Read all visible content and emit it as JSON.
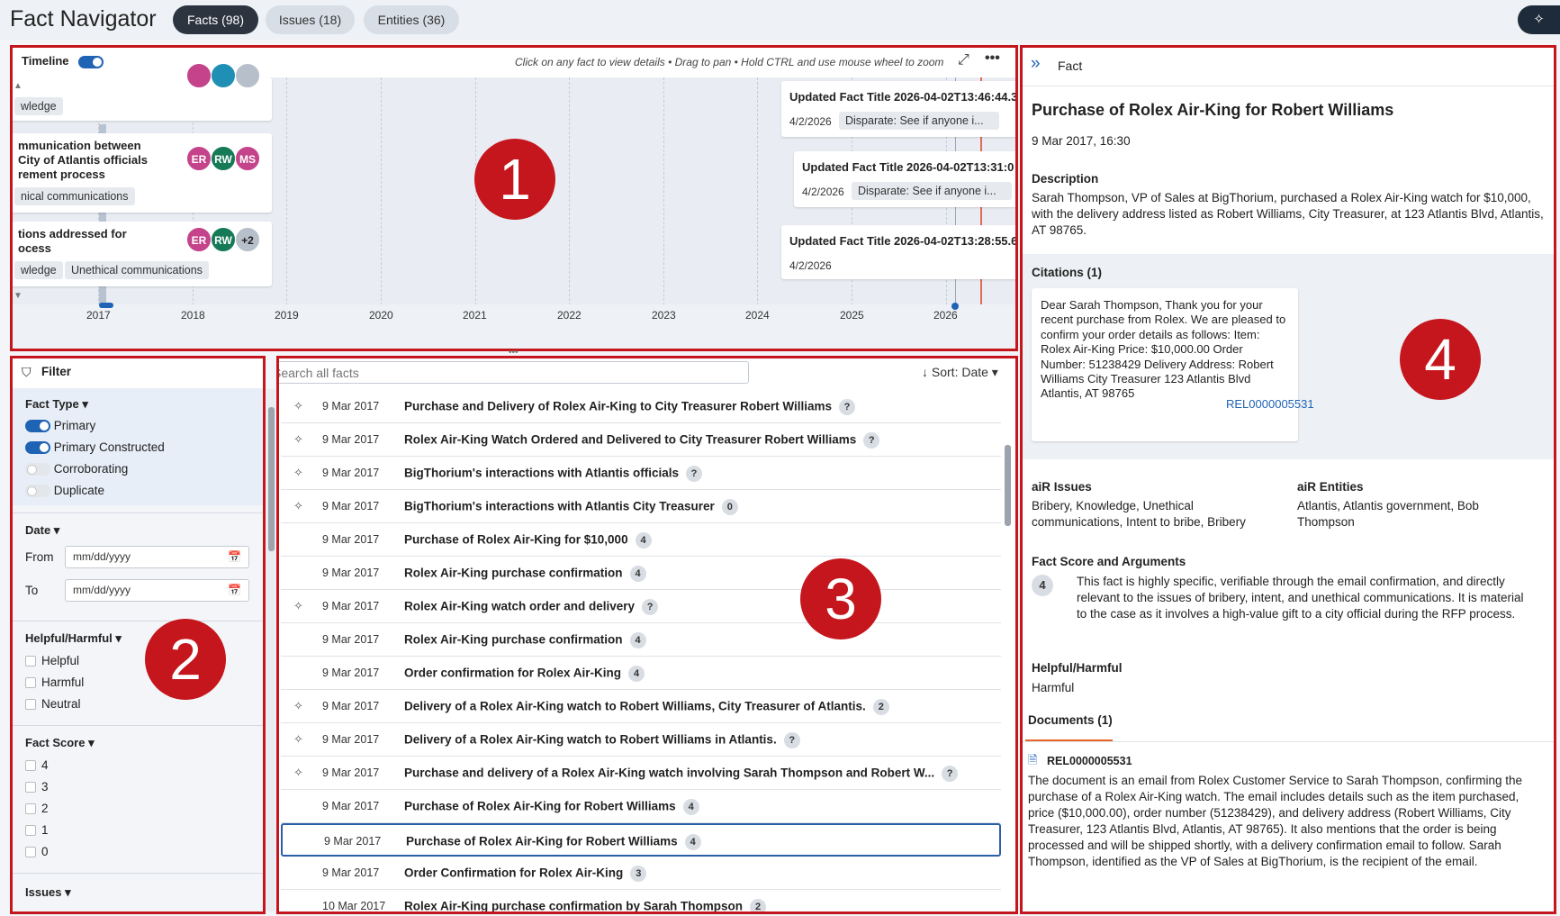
{
  "app": {
    "title": "Fact Navigator"
  },
  "tabs": [
    {
      "label": "Facts (98)"
    },
    {
      "label": "Issues (18)"
    },
    {
      "label": "Entities (36)"
    }
  ],
  "callouts": [
    "1",
    "2",
    "3",
    "4"
  ],
  "timeline": {
    "title": "Timeline",
    "hint": "Click on any fact to view details • Drag to pan • Hold CTRL and use mouse wheel to zoom",
    "years": [
      "2017",
      "2018",
      "2019",
      "2020",
      "2021",
      "2022",
      "2023",
      "2024",
      "2025",
      "2026"
    ],
    "left_cards": [
      {
        "lines": [],
        "chips": [
          "wledge"
        ]
      },
      {
        "lines": [
          "mmunication between",
          "City of Atlantis officials",
          "rement process"
        ],
        "chips": [
          "nical communications"
        ],
        "avatars": [
          "ER",
          "RW",
          "MS"
        ]
      },
      {
        "lines": [
          "tions addressed for",
          "ocess"
        ],
        "chips": [
          "wledge",
          "Unethical communications"
        ],
        "avatars": [
          "ER",
          "RW",
          "+2"
        ]
      }
    ],
    "right_cards": [
      {
        "title": "Updated Fact Title 2026-04-02T13:46:44.3",
        "date": "4/2/2026",
        "chip": "Disparate: See if anyone i..."
      },
      {
        "title": "Updated Fact Title 2026-04-02T13:31:0",
        "date": "4/2/2026",
        "chip": "Disparate: See if anyone i..."
      },
      {
        "title": "Updated Fact Title 2026-04-02T13:28:55.6",
        "date": "4/2/2026"
      }
    ]
  },
  "filter": {
    "title": "Filter",
    "fact_type": {
      "label": "Fact Type",
      "options": [
        {
          "label": "Primary",
          "on": true
        },
        {
          "label": "Primary Constructed",
          "on": true
        },
        {
          "label": "Corroborating",
          "on": false
        },
        {
          "label": "Duplicate",
          "on": false
        }
      ]
    },
    "date": {
      "label": "Date",
      "from_label": "From",
      "to_label": "To",
      "placeholder": "mm/dd/yyyy"
    },
    "helpful": {
      "label": "Helpful/Harmful",
      "options": [
        "Helpful",
        "Harmful",
        "Neutral"
      ]
    },
    "score": {
      "label": "Fact Score",
      "options": [
        "4",
        "3",
        "2",
        "1",
        "0"
      ]
    },
    "issues": {
      "label": "Issues"
    }
  },
  "list": {
    "search_placeholder": "Search all facts",
    "sort_label": "Sort: Date",
    "rows": [
      {
        "ai": true,
        "date": "9 Mar 2017",
        "title": "Purchase and Delivery of Rolex Air-King to City Treasurer Robert Williams",
        "count": "?"
      },
      {
        "ai": true,
        "date": "9 Mar 2017",
        "title": "Rolex Air-King Watch Ordered and Delivered to City Treasurer Robert Williams",
        "count": "?"
      },
      {
        "ai": true,
        "date": "9 Mar 2017",
        "title": "BigThorium's interactions with Atlantis officials",
        "count": "?"
      },
      {
        "ai": true,
        "date": "9 Mar 2017",
        "title": "BigThorium's interactions with Atlantis City Treasurer",
        "count": "0"
      },
      {
        "ai": false,
        "date": "9 Mar 2017",
        "title": "Purchase of Rolex Air-King for $10,000",
        "count": "4"
      },
      {
        "ai": false,
        "date": "9 Mar 2017",
        "title": "Rolex Air-King purchase confirmation",
        "count": "4"
      },
      {
        "ai": true,
        "date": "9 Mar 2017",
        "title": "Rolex Air-King watch order and delivery",
        "count": "?"
      },
      {
        "ai": false,
        "date": "9 Mar 2017",
        "title": "Rolex Air-King purchase confirmation",
        "count": "4"
      },
      {
        "ai": false,
        "date": "9 Mar 2017",
        "title": "Order confirmation for Rolex Air-King",
        "count": "4"
      },
      {
        "ai": true,
        "date": "9 Mar 2017",
        "title": "Delivery of a Rolex Air-King watch to Robert Williams, City Treasurer of Atlantis.",
        "count": "2"
      },
      {
        "ai": true,
        "date": "9 Mar 2017",
        "title": "Delivery of a Rolex Air-King watch to Robert Williams in Atlantis.",
        "count": "?"
      },
      {
        "ai": true,
        "date": "9 Mar 2017",
        "title": "Purchase and delivery of a Rolex Air-King watch involving Sarah Thompson and Robert W...",
        "count": "?"
      },
      {
        "ai": false,
        "date": "9 Mar 2017",
        "title": "Purchase of Rolex Air-King for Robert Williams",
        "count": "4"
      },
      {
        "ai": false,
        "date": "9 Mar 2017",
        "title": "Purchase of Rolex Air-King for Robert Williams",
        "count": "4",
        "selected": true
      },
      {
        "ai": false,
        "date": "9 Mar 2017",
        "title": "Order Confirmation for Rolex Air-King",
        "count": "3"
      },
      {
        "ai": false,
        "date": "10 Mar 2017",
        "title": "Rolex Air-King purchase confirmation by Sarah Thompson",
        "count": "2"
      }
    ]
  },
  "detail": {
    "header": "Fact",
    "title": "Purchase of Rolex Air-King for Robert Williams",
    "datetime": "9 Mar 2017, 16:30",
    "desc_label": "Description",
    "desc": "Sarah Thompson, VP of Sales at BigThorium, purchased a Rolex Air-King watch for $10,000, with the delivery address listed as Robert Williams, City Treasurer, at 123 Atlantis Blvd, Atlantis, AT 98765.",
    "citations_label": "Citations (1)",
    "citation_text": "Dear Sarah Thompson, Thank you for your recent purchase from Rolex. We are pleased to confirm your order details as follows: Item: Rolex Air-King Price: $10,000.00 Order Number: 51238429 Delivery Address: Robert Williams City Treasurer 123 Atlantis Blvd Atlantis, AT 98765",
    "citation_ref": "REL0000005531",
    "issues_label": "aiR Issues",
    "issues": "Bribery, Knowledge, Unethical communications, Intent to bribe, Bribery",
    "entities_label": "aiR Entities",
    "entities": "Atlantis, Atlantis government, Bob Thompson",
    "score_label": "Fact Score and Arguments",
    "score": "4",
    "score_text": "This fact is highly specific, verifiable through the email confirmation, and directly relevant to the issues of bribery, intent, and unethical communications. It is material to the case as it involves a high-value gift to a city official during the RFP process.",
    "hh_label": "Helpful/Harmful",
    "hh_value": "Harmful",
    "documents_label": "Documents (1)",
    "doc_ref": "REL0000005531",
    "doc_text": "The document is an email from Rolex Customer Service to Sarah Thompson, confirming the purchase of a Rolex Air-King watch. The email includes details such as the item purchased, price ($10,000.00), order number (51238429), and delivery address (Robert Williams, City Treasurer, 123 Atlantis Blvd, Atlantis, AT 98765). It also mentions that the order is being processed and will be shipped shortly, with a delivery confirmation email to follow. Sarah Thompson, identified as the VP of Sales at BigThorium, is the recipient of the email."
  },
  "colors": {
    "accent": "#1f63b5",
    "callout": "#c4161c",
    "dark": "#2c3440",
    "doc_tab_underline": "#e8652a"
  }
}
